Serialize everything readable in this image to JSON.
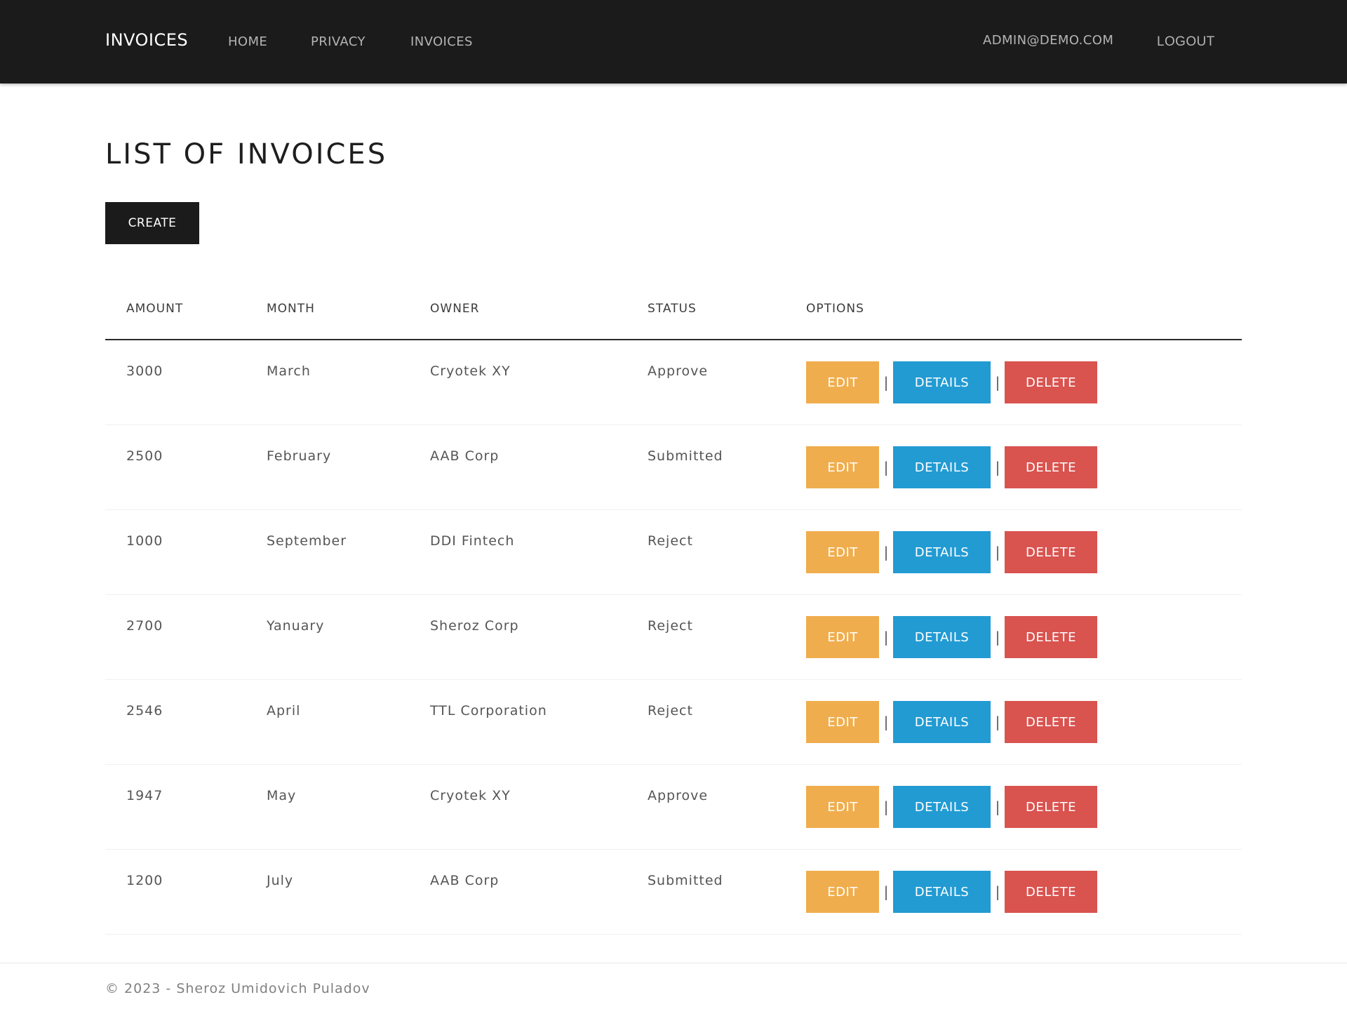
{
  "navbar": {
    "brand": "INVOICES",
    "links": [
      "HOME",
      "PRIVACY",
      "INVOICES"
    ],
    "user": "ADMIN@DEMO.COM",
    "logout": "LOGOUT"
  },
  "page": {
    "title": "LIST OF INVOICES",
    "create_label": "CREATE"
  },
  "table": {
    "headers": [
      "AMOUNT",
      "MONTH",
      "OWNER",
      "STATUS",
      "OPTIONS"
    ],
    "rows": [
      {
        "amount": "3000",
        "month": "March",
        "owner": "Cryotek XY",
        "status": "Approve"
      },
      {
        "amount": "2500",
        "month": "February",
        "owner": "AAB Corp",
        "status": "Submitted"
      },
      {
        "amount": "1000",
        "month": "September",
        "owner": "DDI Fintech",
        "status": "Reject"
      },
      {
        "amount": "2700",
        "month": "Yanuary",
        "owner": "Sheroz Corp",
        "status": "Reject"
      },
      {
        "amount": "2546",
        "month": "April",
        "owner": "TTL Corporation",
        "status": "Reject"
      },
      {
        "amount": "1947",
        "month": "May",
        "owner": "Cryotek XY",
        "status": "Approve"
      },
      {
        "amount": "1200",
        "month": "July",
        "owner": "AAB Corp",
        "status": "Submitted"
      }
    ],
    "actions": {
      "edit": "EDIT",
      "details": "DETAILS",
      "delete": "DELETE",
      "separator": "|"
    }
  },
  "footer": {
    "text": "© 2023 - Sheroz Umidovich Puladov"
  },
  "colors": {
    "navbar_bg": "#1b1b1b",
    "edit": "#f0ad4e",
    "details": "#229bd3",
    "delete": "#d9534f"
  }
}
